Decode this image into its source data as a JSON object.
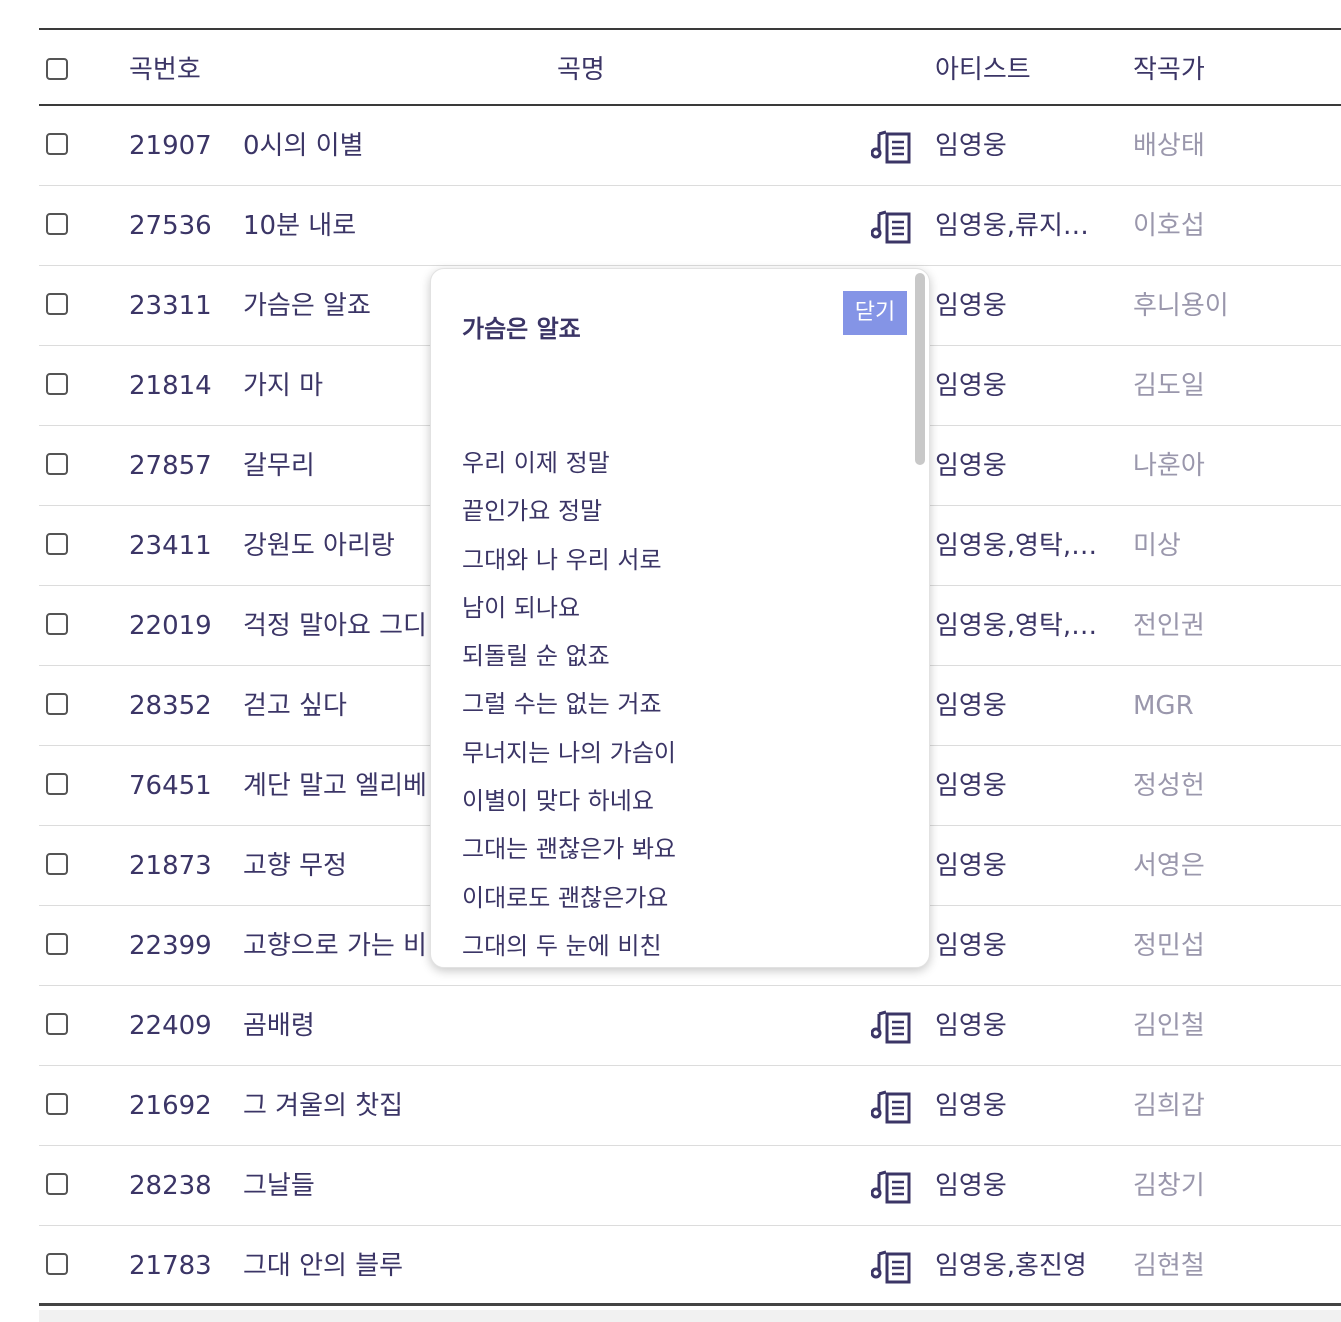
{
  "header": {
    "number": "곡번호",
    "title": "곡명",
    "artist": "아티스트",
    "composer": "작곡가"
  },
  "rows": [
    {
      "number": "21907",
      "title": "0시의 이별",
      "artist": "임영웅",
      "composer": "배상태"
    },
    {
      "number": "27536",
      "title": "10분 내로",
      "artist": "임영웅,류지…",
      "composer": "이호섭"
    },
    {
      "number": "23311",
      "title": "가슴은 알죠",
      "artist": "임영웅",
      "composer": "후니용이"
    },
    {
      "number": "21814",
      "title": "가지 마",
      "artist": "임영웅",
      "composer": "김도일"
    },
    {
      "number": "27857",
      "title": "갈무리",
      "artist": "임영웅",
      "composer": "나훈아"
    },
    {
      "number": "23411",
      "title": "강원도 아리랑",
      "artist": "임영웅,영탁,…",
      "composer": "미상"
    },
    {
      "number": "22019",
      "title": "걱정 말아요 그디",
      "artist": "임영웅,영탁,…",
      "composer": "전인권"
    },
    {
      "number": "28352",
      "title": "걷고 싶다",
      "artist": "임영웅",
      "composer": "MGR"
    },
    {
      "number": "76451",
      "title": "계단 말고 엘리베",
      "artist": "임영웅",
      "composer": "정성헌"
    },
    {
      "number": "21873",
      "title": "고향 무정",
      "artist": "임영웅",
      "composer": "서영은"
    },
    {
      "number": "22399",
      "title": "고향으로 가는 비",
      "artist": "임영웅",
      "composer": "정민섭"
    },
    {
      "number": "22409",
      "title": "곰배령",
      "artist": "임영웅",
      "composer": "김인철"
    },
    {
      "number": "21692",
      "title": "그 겨울의 찻집",
      "artist": "임영웅",
      "composer": "김희갑"
    },
    {
      "number": "28238",
      "title": "그날들",
      "artist": "임영웅",
      "composer": "김창기"
    },
    {
      "number": "21783",
      "title": "그대 안의 블루",
      "artist": "임영웅,홍진영",
      "composer": "김현철"
    }
  ],
  "icons": {
    "lyrics": "music-lyrics-icon"
  },
  "popup": {
    "title": "가슴은 알죠",
    "close_label": "닫기",
    "lyrics": [
      "우리 이제 정말",
      "끝인가요 정말",
      "그대와 나 우리 서로",
      "남이 되나요",
      "되돌릴 순 없죠",
      "그럴 수는 없는 거죠",
      "무너지는 나의 가슴이",
      "이별이 맞다 하네요",
      "그대는 괜찮은가 봐요",
      "이대로도 괜찮은가요",
      "그대의 두 눈에 비친"
    ]
  },
  "colors": {
    "text": "#3b3566",
    "muted": "#9a97ac",
    "accent": "#8494e6"
  }
}
